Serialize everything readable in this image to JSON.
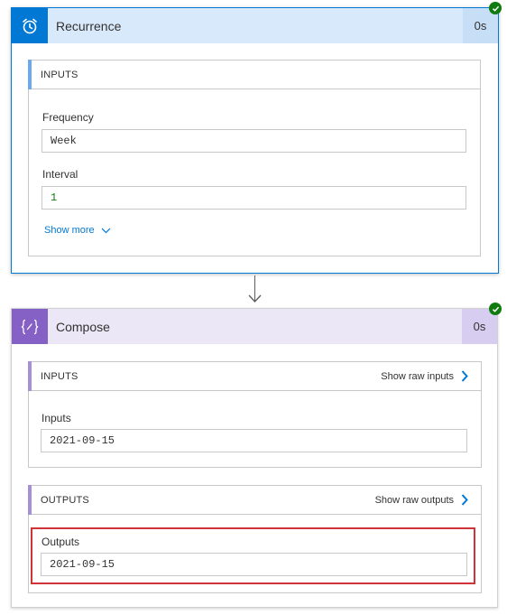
{
  "recurrence": {
    "title": "Recurrence",
    "duration": "0s",
    "icon": "alarm-clock-icon",
    "status": "succeeded",
    "accent_color": "#0078d4",
    "header_bg": "#d8e9fb",
    "inputs": {
      "section_label": "INPUTS",
      "frequency": {
        "label": "Frequency",
        "value": "Week"
      },
      "interval": {
        "label": "Interval",
        "value": "1"
      },
      "show_more_label": "Show more"
    }
  },
  "compose": {
    "title": "Compose",
    "duration": "0s",
    "icon": "curly-braces-icon",
    "status": "succeeded",
    "accent_color": "#8661c5",
    "header_bg": "#ebe7f7",
    "inputs": {
      "section_label": "INPUTS",
      "raw_link_label": "Show raw inputs",
      "field": {
        "label": "Inputs",
        "value": "2021-09-15"
      }
    },
    "outputs": {
      "section_label": "OUTPUTS",
      "raw_link_label": "Show raw outputs",
      "field": {
        "label": "Outputs",
        "value": "2021-09-15"
      }
    }
  },
  "colors": {
    "success": "#107c10",
    "link": "#0078d4",
    "highlight": "#d13438",
    "interval_value": "#107c10"
  }
}
